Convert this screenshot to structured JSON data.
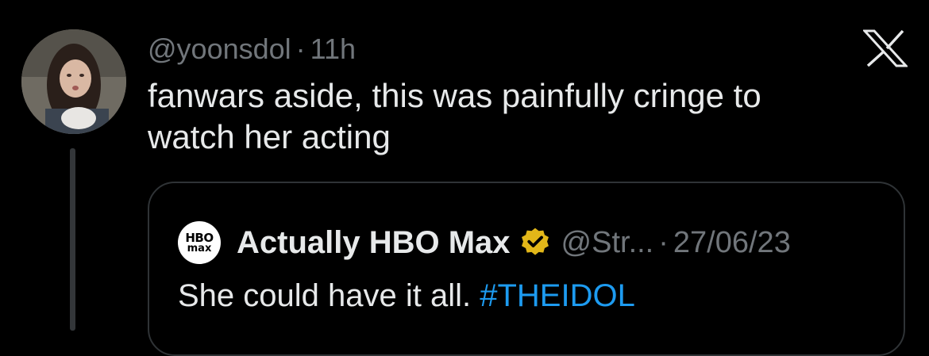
{
  "reply": {
    "handle": "@yoonsdol",
    "separator": "·",
    "time": "11h",
    "text_line1": "fanwars aside, this was painfully cringe to",
    "text_line2": "watch her acting"
  },
  "close_icon": "x-close-icon",
  "quote": {
    "logo_line1": "HBO",
    "logo_line2": "max",
    "name": "Actually HBO Max",
    "verified_icon": "gold-verified-badge-icon",
    "handle": "@Str...",
    "separator": "·",
    "date": "27/06/23",
    "text_plain": "She could have it all. ",
    "hashtag": "#THEIDOL"
  },
  "colors": {
    "background": "#000000",
    "primary_text": "#e7e9ea",
    "secondary_text": "#71767b",
    "link": "#1d9bf0",
    "border": "#2f3336",
    "verified_gold": "#e2b719"
  }
}
